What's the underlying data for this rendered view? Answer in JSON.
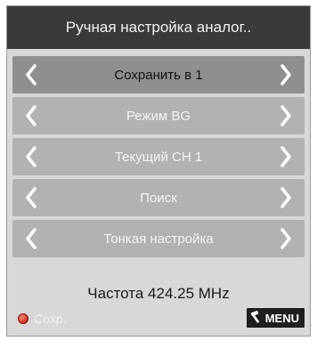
{
  "title": "Ручная настройка аналог..",
  "rows": [
    {
      "label": "Сохранить в 1"
    },
    {
      "label": "Режим BG"
    },
    {
      "label": "Текущий CH 1"
    },
    {
      "label": "Поиск"
    },
    {
      "label": "Тонкая настройка"
    }
  ],
  "selected_index": 0,
  "frequency": "Частота 424.25 MHz",
  "save_label": "Сохр.",
  "menu_label": "MENU",
  "icons": {
    "left": "chevron-left-icon",
    "right": "chevron-right-icon",
    "save": "red-dot-icon",
    "menu": "hammer-icon"
  },
  "colors": {
    "header_bg": "#3a3a3a",
    "row_bg": "#b2b2b2",
    "selected_row_bg": "#8f8f8f",
    "panel_bg": "#d8d8d8",
    "save_dot": "#d22a1a"
  }
}
